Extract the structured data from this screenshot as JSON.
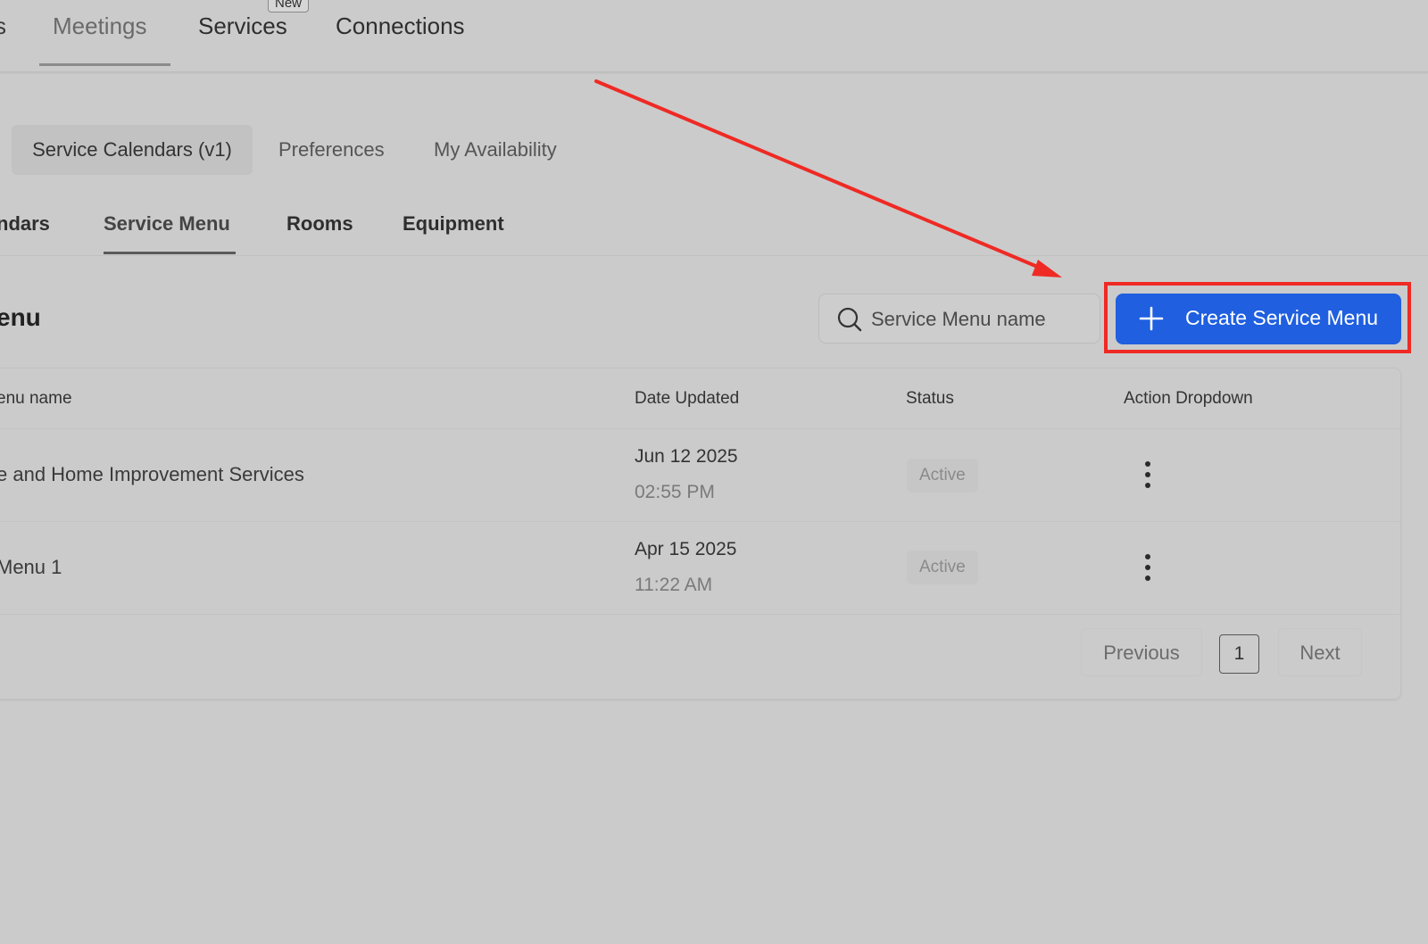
{
  "top_nav": {
    "cut_tab": "s",
    "tabs": [
      {
        "label": "Meetings"
      },
      {
        "label": "Services"
      },
      {
        "label": "Connections"
      }
    ],
    "new_badge": "New"
  },
  "sub_tabs": [
    {
      "label": "Service Calendars (v1)"
    },
    {
      "label": "Preferences"
    },
    {
      "label": "My Availability"
    }
  ],
  "section_tabs": [
    {
      "label": "ndars"
    },
    {
      "label": "Service Menu"
    },
    {
      "label": "Rooms"
    },
    {
      "label": "Equipment"
    }
  ],
  "page_title": "enu",
  "search": {
    "placeholder": "Service Menu name",
    "value": ""
  },
  "create_button": {
    "label": "Create Service Menu"
  },
  "table": {
    "headers": {
      "name": "enu name",
      "date": "Date Updated",
      "status": "Status",
      "action": "Action Dropdown"
    },
    "rows": [
      {
        "name": "e and Home Improvement Services",
        "date": "Jun 12 2025",
        "time": "02:55 PM",
        "status": "Active"
      },
      {
        "name": "Menu 1",
        "date": "Apr 15 2025",
        "time": "11:22 AM",
        "status": "Active"
      }
    ]
  },
  "pagination": {
    "previous": "Previous",
    "page": "1",
    "next": "Next"
  },
  "colors": {
    "accent": "#1f5fe0",
    "annotation": "#ef2a24",
    "background": "#cbcbcb"
  }
}
